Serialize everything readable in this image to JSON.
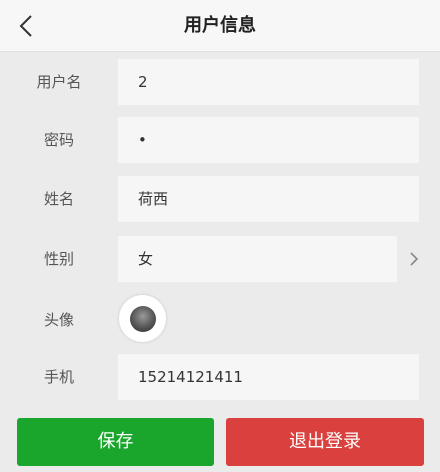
{
  "header": {
    "title": "用户信息",
    "back_icon": "chevron-left-icon"
  },
  "form": {
    "username": {
      "label": "用户名",
      "value": "2"
    },
    "password": {
      "label": "密码",
      "value": "•"
    },
    "name": {
      "label": "姓名",
      "value": "荷西"
    },
    "gender": {
      "label": "性别",
      "value": "女",
      "icon": "chevron-right-icon"
    },
    "avatar": {
      "label": "头像"
    },
    "phone": {
      "label": "手机",
      "value": "15214121411"
    }
  },
  "actions": {
    "save_label": "保存",
    "logout_label": "退出登录"
  },
  "colors": {
    "save": "#1aa52c",
    "logout": "#d9403e",
    "background": "#ebebeb",
    "field": "#f6f6f6"
  }
}
